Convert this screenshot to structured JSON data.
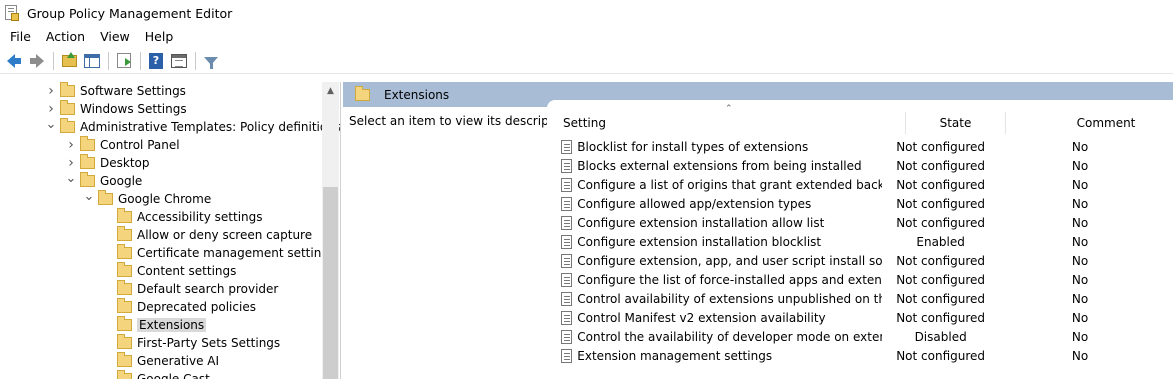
{
  "window": {
    "title": "Group Policy Management Editor"
  },
  "menu": {
    "items": [
      "File",
      "Action",
      "View",
      "Help"
    ]
  },
  "toolbar": {
    "buttons": [
      "back-icon",
      "forward-icon",
      "up-folder-icon",
      "show-hide-tree-icon",
      "export-list-icon",
      "help-icon",
      "properties-icon",
      "filter-icon"
    ],
    "help_glyph": "?"
  },
  "tree": {
    "items": [
      {
        "label": "Software Settings",
        "level": 2,
        "expander": "collapsed"
      },
      {
        "label": "Windows Settings",
        "level": 2,
        "expander": "collapsed"
      },
      {
        "label": "Administrative Templates: Policy definitions",
        "level": 2,
        "expander": "expanded"
      },
      {
        "label": "Control Panel",
        "level": 3,
        "expander": "collapsed"
      },
      {
        "label": "Desktop",
        "level": 3,
        "expander": "collapsed"
      },
      {
        "label": "Google",
        "level": 3,
        "expander": "expanded"
      },
      {
        "label": "Google Chrome",
        "level": 4,
        "expander": "expanded"
      },
      {
        "label": "Accessibility settings",
        "level": 5,
        "expander": "none"
      },
      {
        "label": "Allow or deny screen capture",
        "level": 5,
        "expander": "none"
      },
      {
        "label": "Certificate management settings",
        "level": 5,
        "expander": "none"
      },
      {
        "label": "Content settings",
        "level": 5,
        "expander": "none"
      },
      {
        "label": "Default search provider",
        "level": 5,
        "expander": "none"
      },
      {
        "label": "Deprecated policies",
        "level": 5,
        "expander": "none"
      },
      {
        "label": "Extensions",
        "level": 5,
        "expander": "none",
        "selected": true
      },
      {
        "label": "First-Party Sets Settings",
        "level": 5,
        "expander": "none"
      },
      {
        "label": "Generative AI",
        "level": 5,
        "expander": "none"
      },
      {
        "label": "Google Cast",
        "level": 5,
        "expander": "none"
      }
    ]
  },
  "details": {
    "header_title": "Extensions",
    "description_prompt": "Select an item to view its description.",
    "columns": {
      "setting": "Setting",
      "state": "State",
      "comment": "Comment"
    },
    "rows": [
      {
        "setting": "Blocklist for install types of extensions",
        "state": "Not configured",
        "comment": "No"
      },
      {
        "setting": "Blocks external extensions from being installed",
        "state": "Not configured",
        "comment": "No"
      },
      {
        "setting": "Configure a list of origins that grant extended background li...",
        "state": "Not configured",
        "comment": "No"
      },
      {
        "setting": "Configure allowed app/extension types",
        "state": "Not configured",
        "comment": "No"
      },
      {
        "setting": "Configure extension installation allow list",
        "state": "Not configured",
        "comment": "No"
      },
      {
        "setting": "Configure extension installation blocklist",
        "state": "Enabled",
        "comment": "No"
      },
      {
        "setting": "Configure extension, app, and user script install sources",
        "state": "Not configured",
        "comment": "No"
      },
      {
        "setting": "Configure the list of force-installed apps and extensions",
        "state": "Not configured",
        "comment": "No"
      },
      {
        "setting": "Control availability of extensions unpublished on the Chrom...",
        "state": "Not configured",
        "comment": "No"
      },
      {
        "setting": "Control Manifest v2 extension availability",
        "state": "Not configured",
        "comment": "No"
      },
      {
        "setting": "Control the availability of developer mode on extensions page",
        "state": "Disabled",
        "comment": "No"
      },
      {
        "setting": "Extension management settings",
        "state": "Not configured",
        "comment": "No"
      }
    ]
  },
  "colors": {
    "header_band": "#a8bcd6",
    "selection": "#d9d9d9",
    "folder": "#f4d57d",
    "back_arrow": "#2f7cc9"
  }
}
